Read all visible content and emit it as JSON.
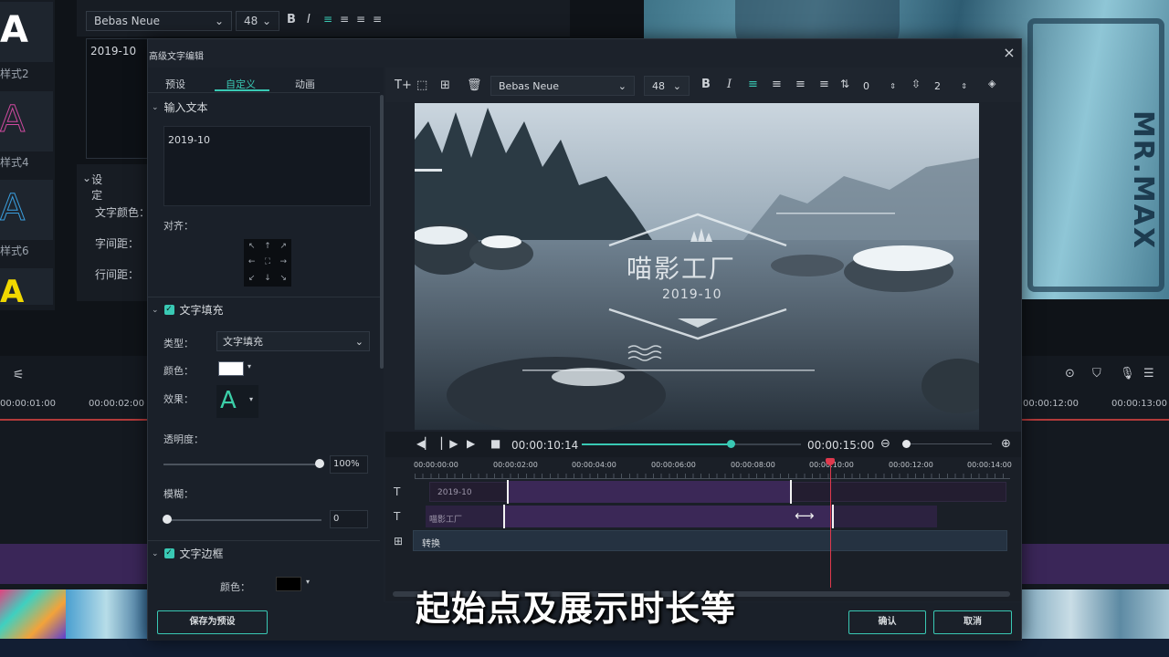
{
  "background": {
    "style_labels": [
      "样式2",
      "样式4",
      "样式6"
    ],
    "font": {
      "family": "Bebas Neue",
      "size": "48"
    },
    "text_value": "2019-10",
    "settings": {
      "header": "设定",
      "text_color": "文字颜色：",
      "letter_spacing": "字间距：",
      "line_spacing": "行间距："
    },
    "ruler": [
      "00:00:01:00",
      "00:00:02:00",
      "00:00:12:00",
      "00:00:13:00"
    ],
    "preview_text": "MR.MAX"
  },
  "dialog": {
    "title": "高级文字编辑",
    "close": "×",
    "tabs": [
      "预设",
      "自定义",
      "动画"
    ],
    "input_section": {
      "title": "输入文本",
      "value": "2019-10",
      "align_label": "对齐："
    },
    "fill_section": {
      "title": "文字填充",
      "type_label": "类型：",
      "type_value": "文字填充",
      "color_label": "颜色：",
      "effect_label": "效果：",
      "effect_glyph": "A",
      "opacity_label": "透明度：",
      "opacity_value": "100%",
      "blur_label": "模糊：",
      "blur_value": "0"
    },
    "border_section": {
      "title": "文字边框",
      "color_label": "颜色："
    },
    "toolbar": {
      "font": "Bebas Neue",
      "size": "48",
      "bold": "B",
      "italic": "I",
      "char_spacing": "0",
      "line_spacing": "2"
    },
    "preview": {
      "title": "喵影工厂",
      "date": "2019-10"
    },
    "playback": {
      "current": "00:00:10:14",
      "total": "00:00:15:00",
      "progress": 0.68
    },
    "timeline": {
      "ruler": [
        "00:00:00:00",
        "00:00:02:00",
        "00:00:04:00",
        "00:00:06:00",
        "00:00:08:00",
        "00:00:10:00",
        "00:00:12:00",
        "00:00:14:00"
      ],
      "tracks": [
        {
          "icon": "T",
          "label": "2019-10"
        },
        {
          "icon": "T",
          "label": "喵影工厂"
        },
        {
          "icon": "⊞",
          "label": "转换"
        }
      ]
    },
    "footer": {
      "save_preset": "保存为预设",
      "ok": "确认",
      "cancel": "取消"
    }
  },
  "subtitle": "起始点及展示时长等",
  "colors": {
    "accent": "#39c9b4",
    "clip": "#3b2857",
    "playhead": "#e0394d"
  }
}
